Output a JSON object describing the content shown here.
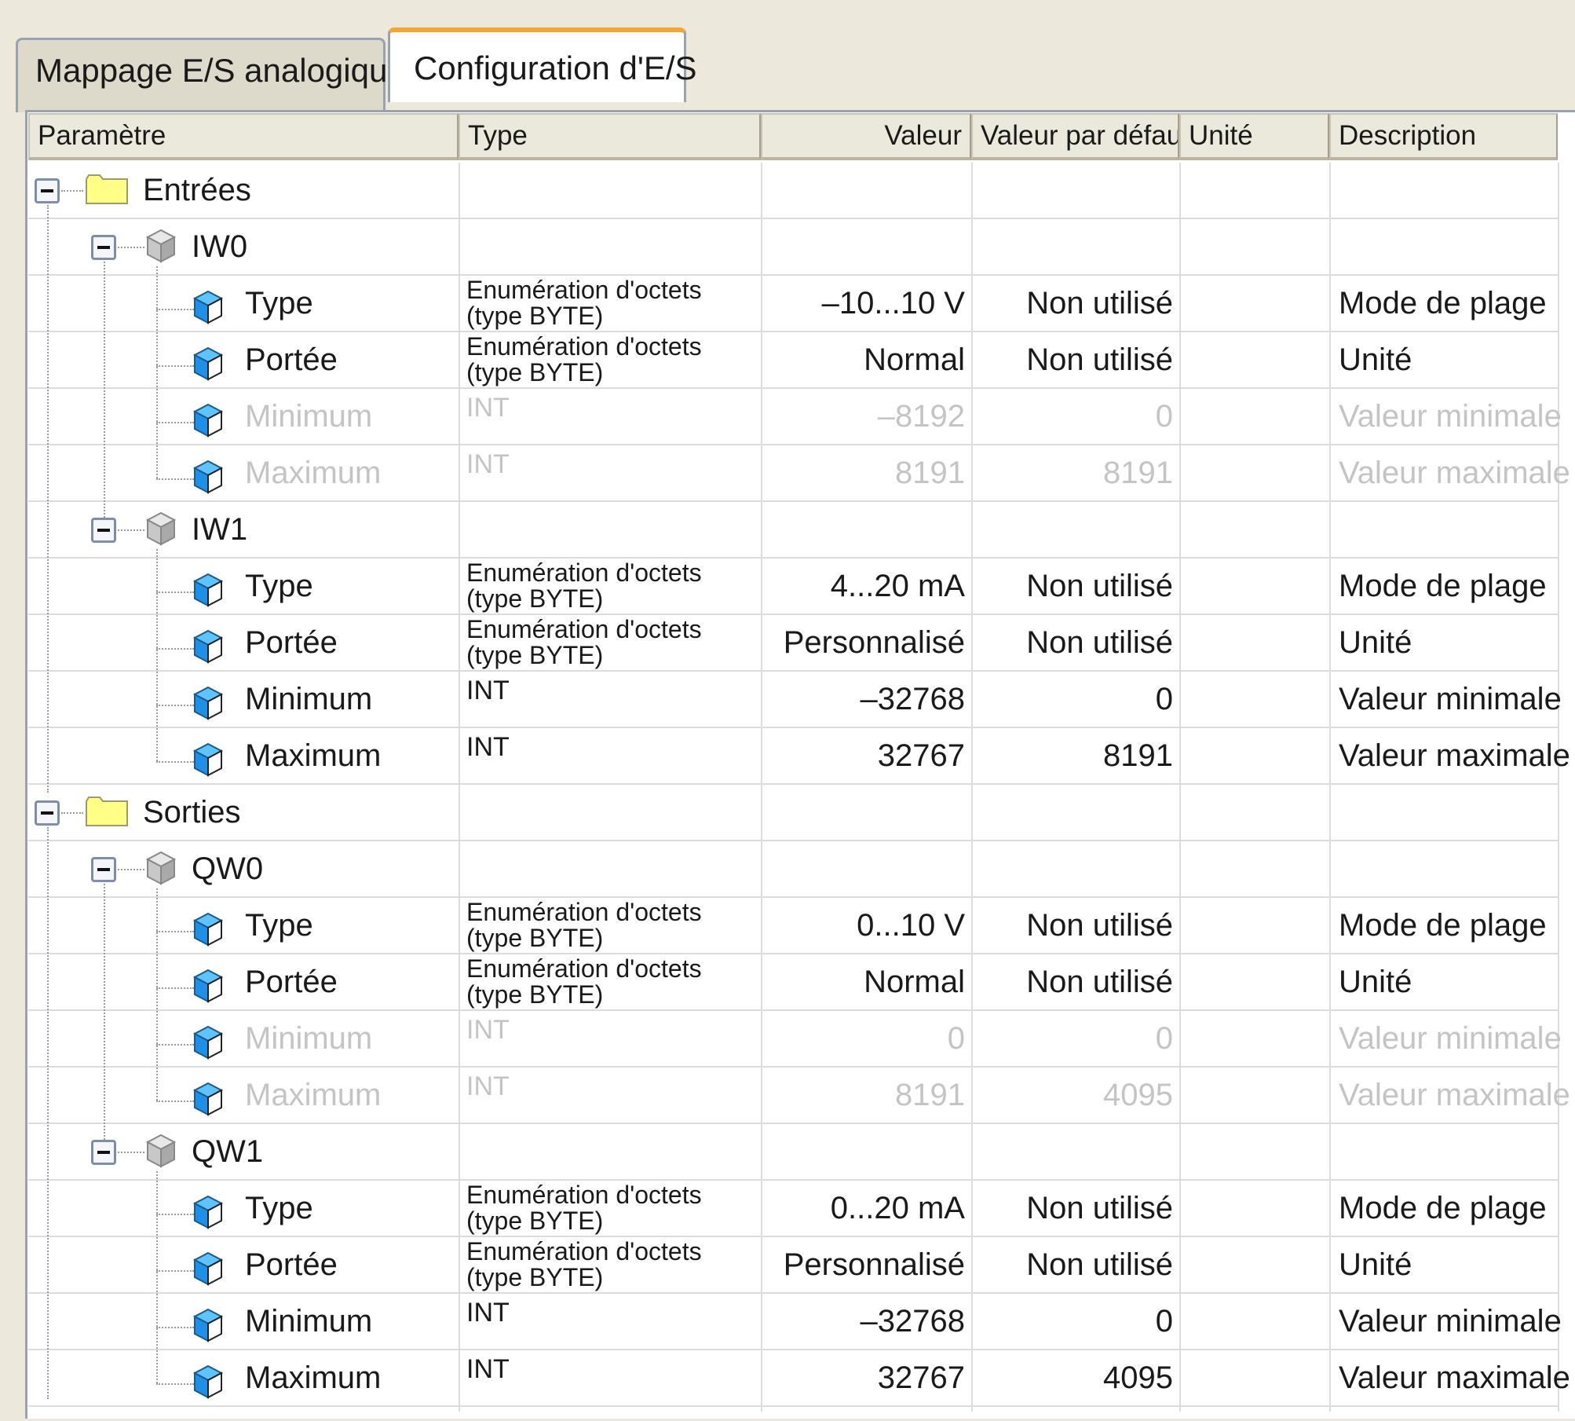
{
  "tabs": [
    {
      "label": "Mappage E/S analogiques",
      "active": false
    },
    {
      "label": "Configuration d'E/S",
      "active": true
    }
  ],
  "colors": {
    "accent_tab": "#f6a530",
    "folder": "#ffff88",
    "param_icon": "#1e90e8"
  },
  "columns": {
    "param": "Paramètre",
    "type": "Type",
    "value": "Valeur",
    "default": "Valeur par défaut",
    "unit": "Unité",
    "description": "Description"
  },
  "rows": [
    {
      "kind": "folder",
      "label": "Entrées"
    },
    {
      "kind": "channel",
      "label": "IW0"
    },
    {
      "kind": "param",
      "label": "Type",
      "type": "Enumération d'octets\n(type BYTE)",
      "value": "–10...10 V",
      "default": "Non utilisé",
      "unit": "",
      "description": "Mode de plage",
      "disabled": false
    },
    {
      "kind": "param",
      "label": "Portée",
      "type": "Enumération d'octets\n(type BYTE)",
      "value": "Normal",
      "default": "Non utilisé",
      "unit": "",
      "description": "Unité",
      "disabled": false
    },
    {
      "kind": "param",
      "label": "Minimum",
      "type": "INT",
      "value": "–8192",
      "default": "0",
      "unit": "",
      "description": "Valeur minimale",
      "disabled": true
    },
    {
      "kind": "param",
      "label": "Maximum",
      "type": "INT",
      "value": "8191",
      "default": "8191",
      "unit": "",
      "description": "Valeur maximale",
      "disabled": true
    },
    {
      "kind": "channel",
      "label": "IW1"
    },
    {
      "kind": "param",
      "label": "Type",
      "type": "Enumération d'octets\n(type BYTE)",
      "value": "4...20 mA",
      "default": "Non utilisé",
      "unit": "",
      "description": "Mode de plage",
      "disabled": false
    },
    {
      "kind": "param",
      "label": "Portée",
      "type": "Enumération d'octets\n(type BYTE)",
      "value": "Personnalisé",
      "default": "Non utilisé",
      "unit": "",
      "description": "Unité",
      "disabled": false
    },
    {
      "kind": "param",
      "label": "Minimum",
      "type": "INT",
      "value": "–32768",
      "default": "0",
      "unit": "",
      "description": "Valeur minimale",
      "disabled": false
    },
    {
      "kind": "param",
      "label": "Maximum",
      "type": "INT",
      "value": "32767",
      "default": "8191",
      "unit": "",
      "description": "Valeur maximale",
      "disabled": false
    },
    {
      "kind": "folder",
      "label": "Sorties"
    },
    {
      "kind": "channel",
      "label": "QW0"
    },
    {
      "kind": "param",
      "label": "Type",
      "type": "Enumération d'octets\n(type BYTE)",
      "value": "0...10 V",
      "default": "Non utilisé",
      "unit": "",
      "description": "Mode de plage",
      "disabled": false
    },
    {
      "kind": "param",
      "label": "Portée",
      "type": "Enumération d'octets\n(type BYTE)",
      "value": "Normal",
      "default": "Non utilisé",
      "unit": "",
      "description": "Unité",
      "disabled": false
    },
    {
      "kind": "param",
      "label": "Minimum",
      "type": "INT",
      "value": "0",
      "default": "0",
      "unit": "",
      "description": "Valeur minimale",
      "disabled": true
    },
    {
      "kind": "param",
      "label": "Maximum",
      "type": "INT",
      "value": "8191",
      "default": "4095",
      "unit": "",
      "description": "Valeur maximale",
      "disabled": true
    },
    {
      "kind": "channel",
      "label": "QW1"
    },
    {
      "kind": "param",
      "label": "Type",
      "type": "Enumération d'octets\n(type BYTE)",
      "value": "0...20 mA",
      "default": "Non utilisé",
      "unit": "",
      "description": "Mode de plage",
      "disabled": false
    },
    {
      "kind": "param",
      "label": "Portée",
      "type": "Enumération d'octets\n(type BYTE)",
      "value": "Personnalisé",
      "default": "Non utilisé",
      "unit": "",
      "description": "Unité",
      "disabled": false
    },
    {
      "kind": "param",
      "label": "Minimum",
      "type": "INT",
      "value": "–32768",
      "default": "0",
      "unit": "",
      "description": "Valeur minimale",
      "disabled": false
    },
    {
      "kind": "param",
      "label": "Maximum",
      "type": "INT",
      "value": "32767",
      "default": "4095",
      "unit": "",
      "description": "Valeur maximale",
      "disabled": false
    }
  ]
}
